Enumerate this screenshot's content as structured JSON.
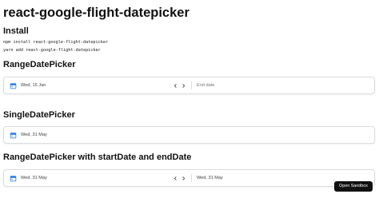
{
  "page": {
    "title": "react-google-flight-datepicker"
  },
  "install": {
    "heading": "Install",
    "npm_command": "npm install react-google-flight-datepicker",
    "yarn_command": "yarn add react-google-flight-datepicker"
  },
  "range_picker": {
    "heading": "RangeDatePicker",
    "start_value": "Wed, 15 Jan",
    "end_placeholder": "End date"
  },
  "single_picker": {
    "heading": "SingleDatePicker",
    "value": "Wed, 31 May"
  },
  "range_picker_dates": {
    "heading": "RangeDatePicker with startDate and endDate",
    "start_value": "Wed, 31 May",
    "end_value": "Wed, 31 May"
  },
  "sandbox_button": {
    "label": "Open Sandbox"
  },
  "colors": {
    "accent": "#1a73e8",
    "border": "#dadce0",
    "button_bg": "#111111"
  },
  "icons": {
    "calendar": "calendar-icon",
    "prev": "chevron-left-icon",
    "next": "chevron-right-icon"
  }
}
